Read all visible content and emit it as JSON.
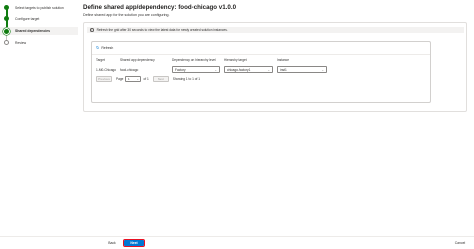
{
  "wizard": {
    "steps": [
      {
        "label": "Select targets to publish solution",
        "state": "complete"
      },
      {
        "label": "Configure target",
        "state": "complete"
      },
      {
        "label": "Shared dependencies",
        "state": "current"
      },
      {
        "label": "Review",
        "state": "pending"
      }
    ]
  },
  "page": {
    "title": "Define shared app/dependency: food-chicago v1.0.0",
    "subtitle": "Define shared app for the solution you are configuring."
  },
  "banner": {
    "icon": "info-icon",
    "text": "Refresh the grid after 30 seconds to view the latest data for newly created solution instances."
  },
  "grid": {
    "refresh_label": "Refresh",
    "columns": [
      "Target",
      "Shared app dependency",
      "Dependency on hierarchy level",
      "Hierarchy target",
      "Instance"
    ],
    "row": {
      "target": "1-M0-Chicago",
      "shared_app": "food-chicago",
      "hierarchy_level": "Factory",
      "hierarchy_target": "chicago-factory1",
      "instance": "inst1"
    },
    "pager": {
      "previous": "Previous",
      "page_label": "Page",
      "page_value": "1",
      "of_label": "of 1",
      "next": "Next",
      "showing": "Showing 1 to 1 of 1"
    }
  },
  "footer": {
    "back_label": "Back",
    "next_label": "Next",
    "cancel_label": "Cancel"
  }
}
